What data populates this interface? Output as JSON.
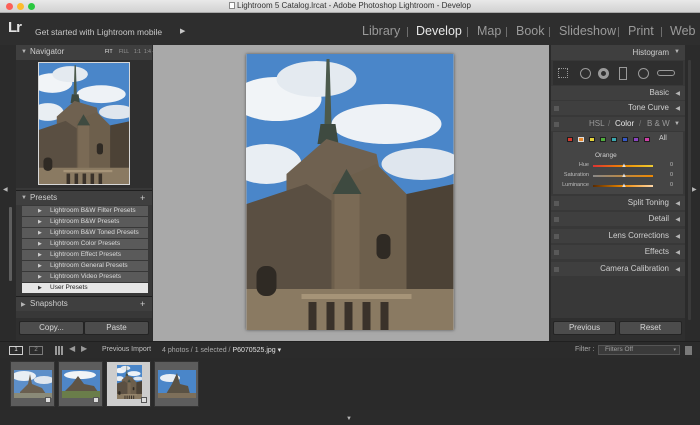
{
  "window": {
    "title": "Lightroom 5 Catalog.lrcat - Adobe Photoshop Lightroom - Develop"
  },
  "identity": {
    "logo": "Lr",
    "mobile_text": "Get started with Lightroom mobile",
    "mobile_arrow": "▶"
  },
  "modules": [
    "Library",
    "Develop",
    "Map",
    "Book",
    "Slideshow",
    "Print",
    "Web"
  ],
  "active_module": "Develop",
  "navigator": {
    "title": "Navigator",
    "zoom_options": [
      "FIT",
      "FILL",
      "1:1",
      "1:4 ÷"
    ]
  },
  "presets": {
    "title": "Presets",
    "add": "+",
    "items": [
      "Lightroom B&W Filter Presets",
      "Lightroom B&W Presets",
      "Lightroom B&W Toned Presets",
      "Lightroom Color Presets",
      "Lightroom Effect Presets",
      "Lightroom General Presets",
      "Lightroom Video Presets",
      "User Presets"
    ]
  },
  "snapshots": {
    "title": "Snapshots",
    "add": "+"
  },
  "left_buttons": {
    "copy": "Copy...",
    "paste": "Paste"
  },
  "right_panels": {
    "histogram": "Histogram",
    "basic": "Basic",
    "tone_curve": "Tone Curve",
    "hsl": {
      "hsl": "HSL",
      "slash1": "/",
      "color": "Color",
      "slash2": "/",
      "bw": "B & W"
    },
    "all": "All",
    "orange": "Orange",
    "sliders": [
      {
        "label": "Hue",
        "value": "0"
      },
      {
        "label": "Saturation",
        "value": "0"
      },
      {
        "label": "Luminance",
        "value": "0"
      }
    ],
    "split_toning": "Split Toning",
    "detail": "Detail",
    "lens_corrections": "Lens Corrections",
    "effects": "Effects",
    "camera_calibration": "Camera Calibration"
  },
  "right_buttons": {
    "previous": "Previous",
    "reset": "Reset"
  },
  "filmstrip": {
    "view1": "1",
    "view2": "2",
    "source": "Previous Import",
    "count": "4 photos / 1 selected /",
    "filename": "P6070525.jpg",
    "filename_arrow": "▾",
    "filter_label": "Filter :",
    "filter_value": "Filters Off",
    "selected_index": 2
  },
  "colors": {
    "accent": "#e8e8e8",
    "panel": "#383838",
    "background": "#2b2b2b",
    "sky": "#4a86c9"
  }
}
